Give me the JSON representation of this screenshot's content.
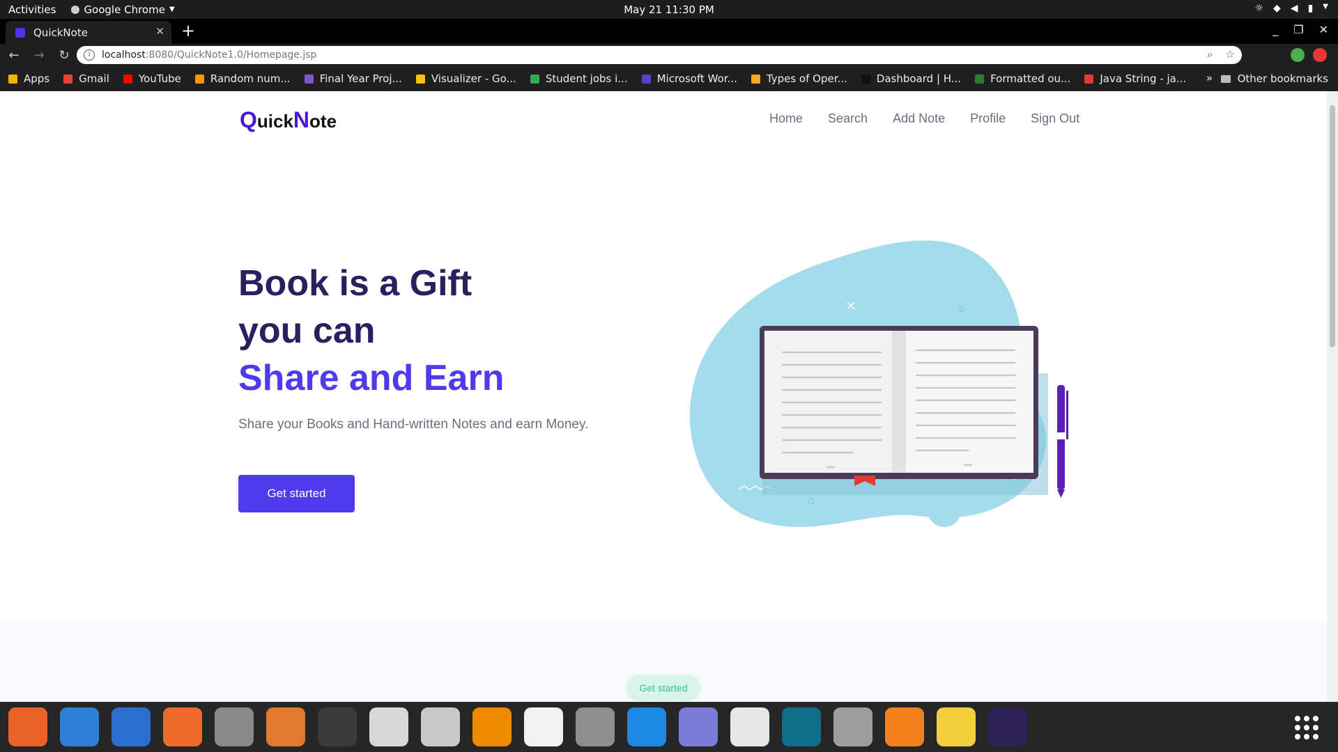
{
  "topbar": {
    "activities": "Activities",
    "app_name": "Google Chrome",
    "clock": "May 21  11:30 PM"
  },
  "tab": {
    "title": "QuickNote",
    "new_tab": "+"
  },
  "omnibox": {
    "url_host": "localhost",
    "url_rest": ":8080/QuickNote1.0/Homepage.jsp"
  },
  "bookmarks": {
    "items": [
      {
        "label": "Apps",
        "color": "#f4b400"
      },
      {
        "label": "Gmail",
        "color": "#ea4335"
      },
      {
        "label": "YouTube",
        "color": "#ff0000"
      },
      {
        "label": "Random num...",
        "color": "#ff9800"
      },
      {
        "label": "Final Year Proj...",
        "color": "#7e57c2"
      },
      {
        "label": "Visualizer - Go...",
        "color": "#f4c20d"
      },
      {
        "label": "Student jobs i...",
        "color": "#34a853"
      },
      {
        "label": "Microsoft Wor...",
        "color": "#5b3ec8"
      },
      {
        "label": "Types of Oper...",
        "color": "#f9a825"
      },
      {
        "label": "Dashboard | H...",
        "color": "#111111"
      },
      {
        "label": "Formatted ou...",
        "color": "#2e7d32"
      },
      {
        "label": "Java String - ja...",
        "color": "#e53935"
      }
    ],
    "more": "»",
    "other": "Other bookmarks"
  },
  "site": {
    "logo_q": "Q",
    "logo_uick": "uick",
    "logo_n": "N",
    "logo_ote": "ote",
    "nav": [
      "Home",
      "Search",
      "Add Note",
      "Profile",
      "Sign Out"
    ],
    "hero_line1": "Book is a Gift",
    "hero_line2": "you can",
    "hero_line3": "Share and Earn",
    "hero_sub": "Share your Books and Hand-written Notes and earn Money.",
    "cta": "Get started",
    "pill": "Get started"
  },
  "colors": {
    "brand": "#4f3bed",
    "heading": "#28205f",
    "blob": "#a5dcec"
  },
  "dock": [
    {
      "name": "firefox-icon",
      "bg": "#e8632a"
    },
    {
      "name": "thunderbird-icon",
      "bg": "#2f7fd7"
    },
    {
      "name": "writer-icon",
      "bg": "#2a6fcf"
    },
    {
      "name": "software-center-icon",
      "bg": "#f06a2b"
    },
    {
      "name": "database-icon",
      "bg": "#8a8a8a"
    },
    {
      "name": "impress-icon",
      "bg": "#e07a2f"
    },
    {
      "name": "terminal-icon",
      "bg": "#3a3a3a"
    },
    {
      "name": "files-icon",
      "bg": "#d8d8d8"
    },
    {
      "name": "search-tool-icon",
      "bg": "#c9c9c9"
    },
    {
      "name": "vlc-icon",
      "bg": "#f08a00"
    },
    {
      "name": "text-editor-icon",
      "bg": "#f2f2f2"
    },
    {
      "name": "settings-icon",
      "bg": "#8f8f8f"
    },
    {
      "name": "vscode-icon",
      "bg": "#1e88e5"
    },
    {
      "name": "screenshot-icon",
      "bg": "#7b7bd8"
    },
    {
      "name": "chrome-icon",
      "bg": "#e8e8e8"
    },
    {
      "name": "sidebar-app-icon",
      "bg": "#106d8a"
    },
    {
      "name": "gimp-icon",
      "bg": "#9e9e9e"
    },
    {
      "name": "blender-icon",
      "bg": "#f27f1b"
    },
    {
      "name": "rhythmbox-icon",
      "bg": "#f4d03f"
    },
    {
      "name": "eclipse-icon",
      "bg": "#2c2255"
    }
  ]
}
